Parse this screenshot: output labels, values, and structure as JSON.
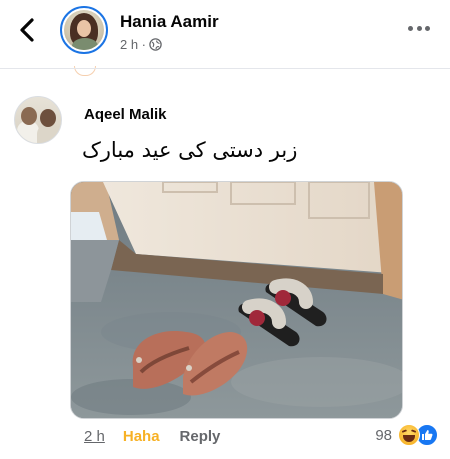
{
  "post": {
    "author": "Hania Aamir",
    "time": "2 h ·",
    "privacy_icon": "globe-icon"
  },
  "comment": {
    "author": "Aqeel Malik",
    "text": "زبر دستی کی عید مبارک",
    "image_description_icon": "photo-of-shoes-at-door",
    "time": "2 h",
    "reaction_label": "Haha",
    "reply_label": "Reply",
    "reaction_count": "98",
    "reaction_icons": [
      "haha-icon",
      "like-icon"
    ]
  },
  "colors": {
    "haha": "#f7b125",
    "like": "#1877f2",
    "meta": "#65676b",
    "ring": "#1b74e4"
  }
}
